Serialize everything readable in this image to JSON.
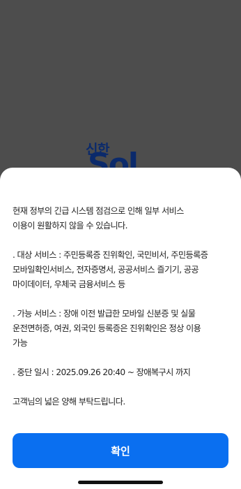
{
  "background": {
    "brand_small": "신한",
    "brand_large": "Sol"
  },
  "notice": {
    "paragraphs": [
      [
        "현재 정부의 긴급 시스템 점검으로 인해 일부 서비스",
        "이용이 원활하지 않을 수 있습니다."
      ],
      [
        ". 대상 서비스 : 주민등록증 진위확인, 국민비서, 주민등록증",
        "모바일확인서비스, 전자증명서, 공공서비스 즐기기, 공공",
        "마이데이터, 우체국 금융서비스 등"
      ],
      [
        ". 가능 서비스 : 장애 이전 발급한 모바일 신분증 및 실물",
        "운전면허증, 여권, 외국인 등록증은 진위확인은 정상 이용",
        "가능"
      ],
      [
        ". 중단 일시 : 2025.09.26 20:40 ~ 장애복구시 까지"
      ],
      [
        "고객님의 넓은 양해 부탁드립니다."
      ]
    ],
    "confirm_label": "확인"
  },
  "colors": {
    "overlay": "#4d4d4d",
    "brand": "#0b2a6b",
    "accent": "#0a6ff0",
    "sheet": "#ffffff"
  }
}
